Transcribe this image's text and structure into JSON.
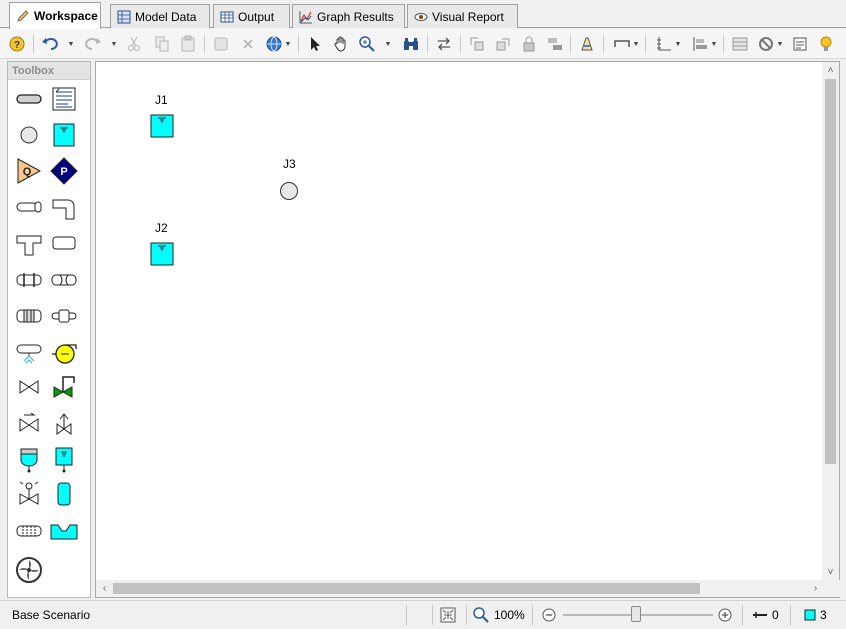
{
  "tabs": [
    {
      "label": "Workspace",
      "icon": "pencil-icon",
      "active": true
    },
    {
      "label": "Model Data",
      "icon": "model-data-icon",
      "active": false
    },
    {
      "label": "Output",
      "icon": "output-table-icon",
      "active": false
    },
    {
      "label": "Graph Results",
      "icon": "graph-icon",
      "active": false
    },
    {
      "label": "Visual Report",
      "icon": "eye-icon",
      "active": false
    }
  ],
  "toolbox": {
    "title": "Toolbox"
  },
  "workspace": {
    "nodes": [
      {
        "id": "J1",
        "label": "J1",
        "type": "reservoir"
      },
      {
        "id": "J3",
        "label": "J3",
        "type": "branch"
      },
      {
        "id": "J2",
        "label": "J2",
        "type": "reservoir"
      }
    ]
  },
  "status": {
    "scenario": "Base Scenario",
    "zoom": "100%",
    "pipe_count": "0",
    "junction_count": "3"
  },
  "colors": {
    "reservoir_fill": "#00ffff",
    "accent": "#00007f",
    "pump_yellow": "#ffff00",
    "valve_green": "#00a000"
  }
}
